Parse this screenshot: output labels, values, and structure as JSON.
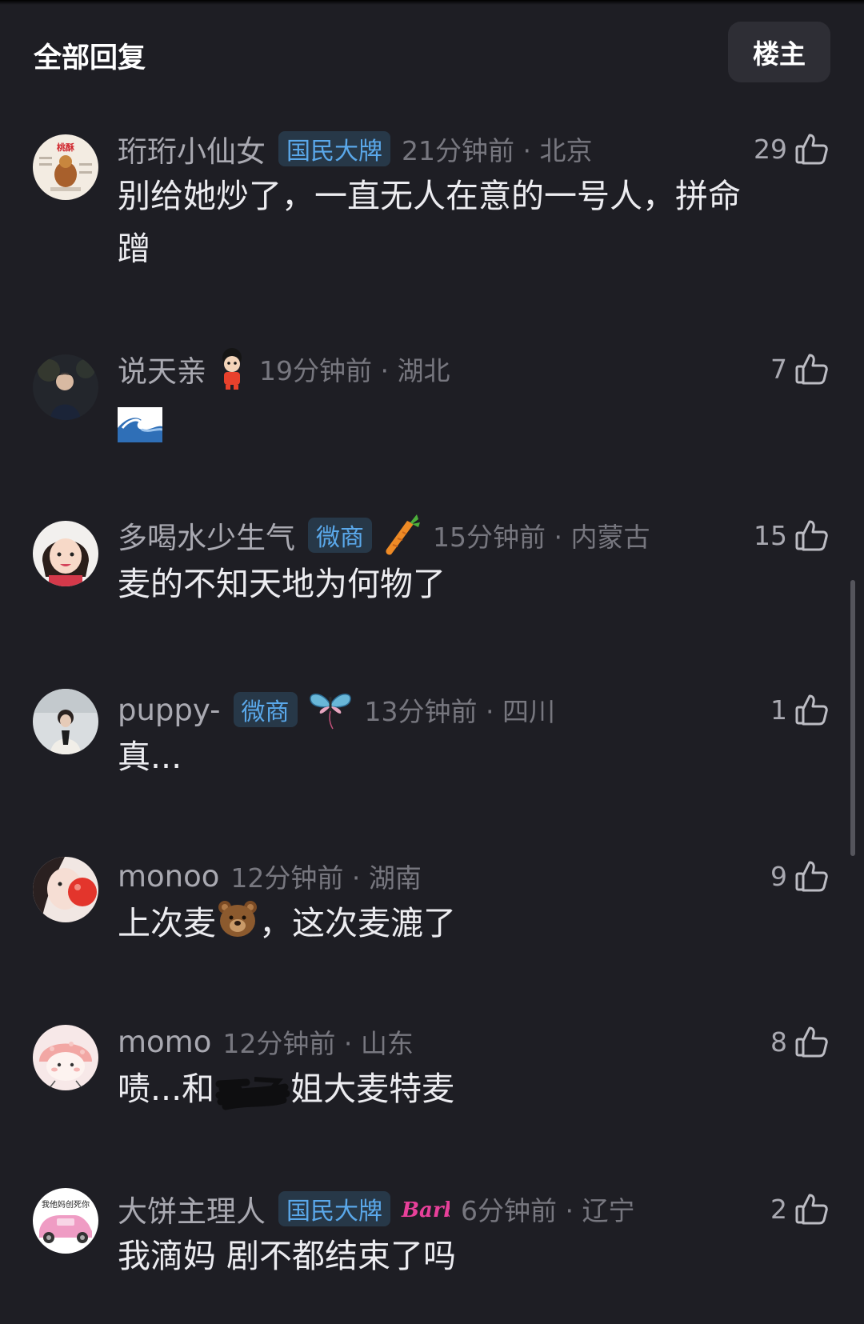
{
  "header": {
    "title": "全部回复",
    "filter_label": "楼主"
  },
  "comments": [
    {
      "username": "珩珩小仙女",
      "badge": "国民大牌",
      "time": "21分钟前 · 北京",
      "likes": "29",
      "text_line1": "别给她炒了，一直无人在意的一号人，拼命",
      "text_line2": "蹭",
      "avatar_text": "桃酥"
    },
    {
      "username": "说天亲",
      "time": "19分钟前 · 湖北",
      "likes": "7",
      "text": "🌊"
    },
    {
      "username": "多喝水少生气",
      "badge": "微商",
      "time": "15分钟前 · 内蒙古",
      "likes": "15",
      "text": "麦的不知天地为何物了"
    },
    {
      "username": "puppy-",
      "badge": "微商",
      "time": "13分钟前 · 四川",
      "likes": "1",
      "text": "真..."
    },
    {
      "username": "monoo",
      "time": "12分钟前 · 湖南",
      "likes": "9",
      "text_before": "上次麦",
      "text_after": "，这次麦漉了"
    },
    {
      "username": "momo",
      "time": "12分钟前 · 山东",
      "likes": "8",
      "text_before": "啧...和",
      "text_after": "姐大麦特麦"
    },
    {
      "username": "大饼主理人",
      "badge": "国民大牌",
      "deco_text": "Barbie",
      "time": "6分钟前 · 辽宁",
      "likes": "2",
      "text": "我滴妈 剧不都结束了吗",
      "avatar_text": "我他妈创死你"
    }
  ],
  "colors": {
    "background": "#1e1e24",
    "username": "#a9a9b1",
    "meta": "#77777f",
    "badge_text": "#5aa8ea",
    "badge_bg": "#273848"
  },
  "icons": [
    "thumbs-up-icon",
    "scrollbar"
  ]
}
